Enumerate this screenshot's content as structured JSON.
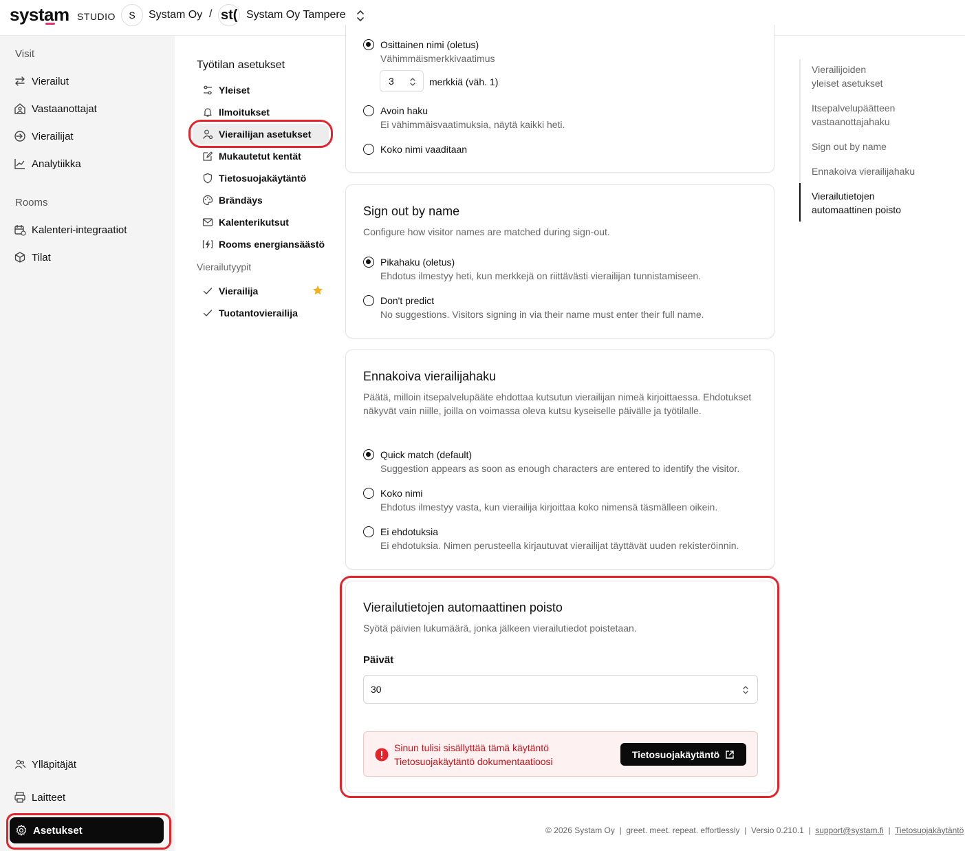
{
  "header": {
    "logo": "systam",
    "logo_sub": "STUDIO",
    "org_initial": "S",
    "org_name": "Systam Oy",
    "separator": "/",
    "workspace_logo": "st(",
    "workspace_name": "Systam Oy Tampere"
  },
  "sidebar": {
    "section_visits": "Visit",
    "items_visits": [
      "Vierailut",
      "Vastaanottajat",
      "Vierailijat",
      "Analytiikka"
    ],
    "section_rooms": "Rooms",
    "items_rooms": [
      "Kalenteri-integraatiot",
      "Tilat"
    ],
    "bottom_items": [
      "Ylläpitäjät",
      "Laitteet"
    ],
    "active_item": "Asetukset"
  },
  "subnav": {
    "title": "Työtilan asetukset",
    "items": [
      "Yleiset",
      "Ilmoitukset",
      "Vierailijan asetukset",
      "Mukautetut kentät",
      "Tietosuojakäytäntö",
      "Brändäys",
      "Kalenterikutsut",
      "Rooms energiansäästö"
    ],
    "section_visit_types": "Vierailutyypit",
    "visit_types": [
      "Vierailija",
      "Tuotantovierailija"
    ]
  },
  "card_search": {
    "opt1_label": "Osittainen nimi (oletus)",
    "opt1_sub": "Vähimmäismerkkivaatimus",
    "min_chars_value": "3",
    "min_chars_label": "merkkiä (väh. 1)",
    "opt2_label": "Avoin haku",
    "opt2_sub": "Ei vähimmäisvaatimuksia, näytä kaikki heti.",
    "opt3_label": "Koko nimi vaaditaan"
  },
  "card_signout": {
    "title": "Sign out by name",
    "desc": "Configure how visitor names are matched during sign-out.",
    "opt1_label": "Pikahaku (oletus)",
    "opt1_sub": "Ehdotus ilmestyy heti, kun merkkejä on riittävästi vierailijan tunnistamiseen.",
    "opt2_label": "Don't predict",
    "opt2_sub": "No suggestions. Visitors signing in via their name must enter their full name."
  },
  "card_predictive": {
    "title": "Ennakoiva vierailijahaku",
    "desc": "Päätä, milloin itsepalvelupääte ehdottaa kutsutun vierailijan nimeä kirjoittaessa. Ehdotukset näkyvät vain niille, joilla on voimassa oleva kutsu kyseiselle päivälle ja työtilalle.",
    "opt1_label": "Quick match (default)",
    "opt1_sub": "Suggestion appears as soon as enough characters are entered to identify the visitor.",
    "opt2_label": "Koko nimi",
    "opt2_sub": "Ehdotus ilmestyy vasta, kun vierailija kirjoittaa koko nimensä täsmälleen oikein.",
    "opt3_label": "Ei ehdotuksia",
    "opt3_sub": "Ei ehdotuksia. Nimen perusteella kirjautuvat vierailijat täyttävät uuden rekisteröinnin."
  },
  "card_autodelete": {
    "title": "Vierailutietojen automaattinen poisto",
    "desc": "Syötä päivien lukumäärä, jonka jälkeen vierailutiedot poistetaan.",
    "field_label": "Päivät",
    "days_value": "30",
    "alert_line1": "Sinun tulisi sisällyttää tämä käytäntö",
    "alert_line2": "Tietosuojakäytäntö dokumentaatioosi",
    "alert_button": "Tietosuojakäytäntö"
  },
  "toc": {
    "items": [
      "Vierailijoiden yleiset asetukset",
      "Itsepalvelupäätteen vastaanottajahaku",
      "Sign out by name",
      "Ennakoiva vierailijahaku",
      "Vierailutietojen automaattinen poisto"
    ]
  },
  "footer": {
    "copyright": "© 2026 Systam Oy",
    "tagline": "greet. meet. repeat. effortlessly",
    "version": "Versio 0.210.1",
    "support": "support@systam.fi",
    "privacy": "Tietosuojakäytäntö"
  },
  "colors": {
    "accent_pink": "#e6336b",
    "highlight_red": "#e3242b",
    "alert_text": "#c4161c",
    "star": "#f2b01e"
  }
}
